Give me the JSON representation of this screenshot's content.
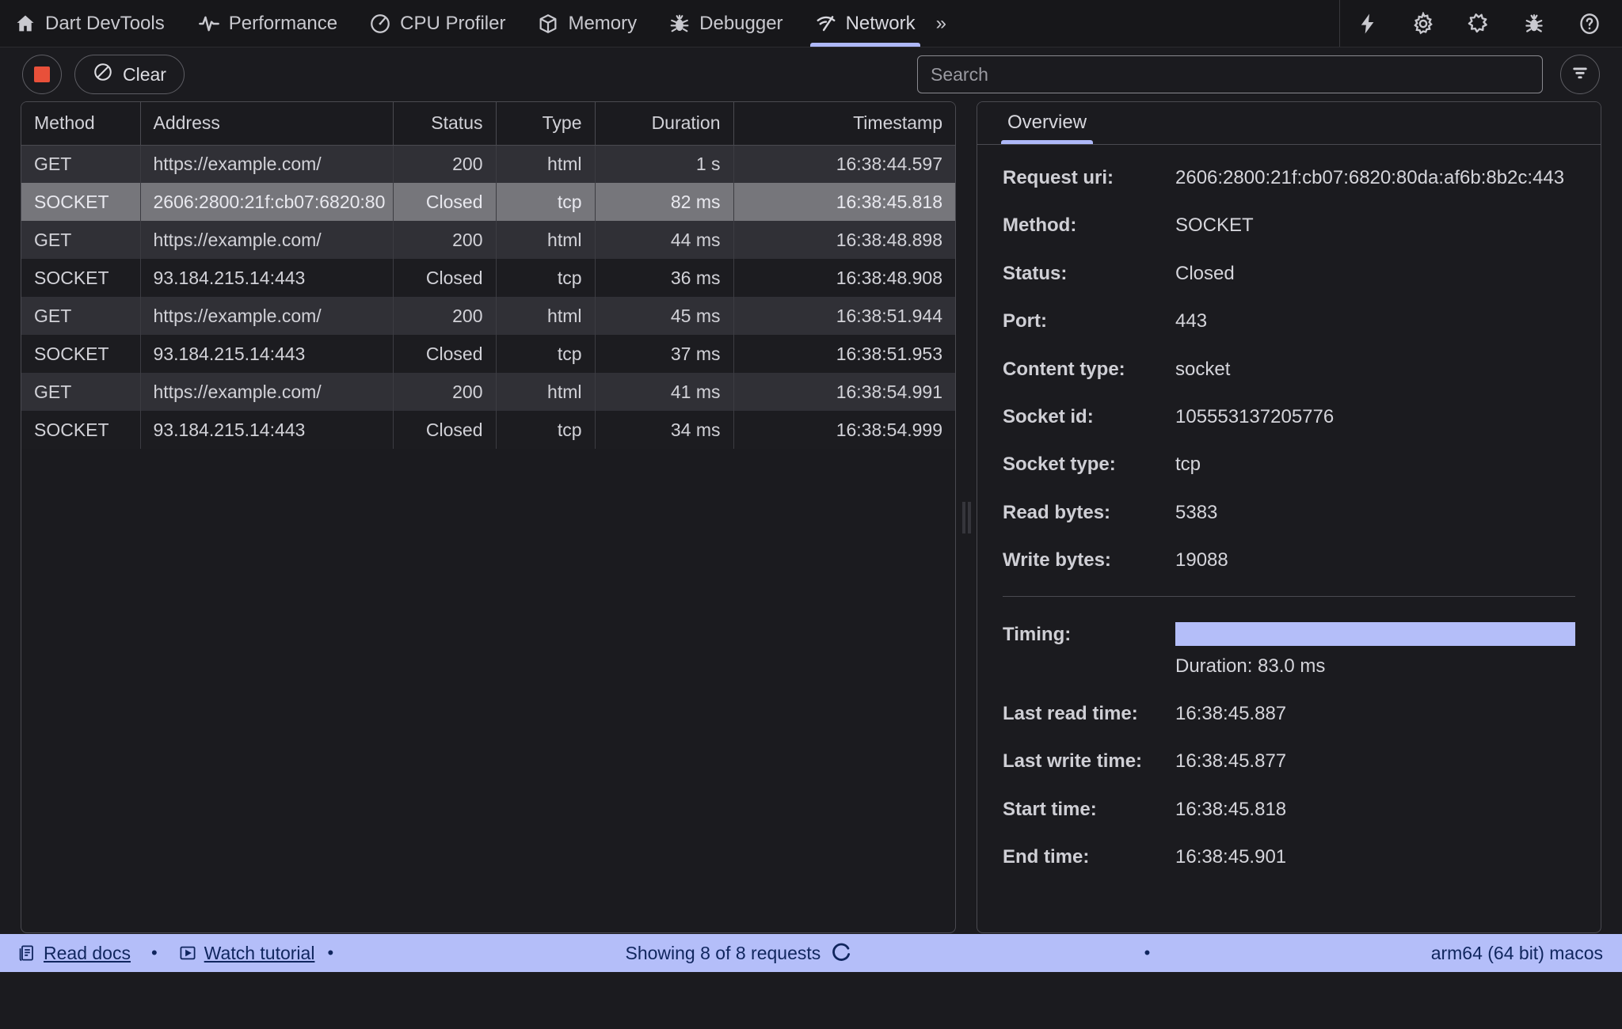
{
  "app": {
    "title": "Dart DevTools"
  },
  "nav": {
    "tabs": [
      {
        "label": "Dart DevTools",
        "icon": "home-icon",
        "active": false
      },
      {
        "label": "Performance",
        "icon": "pulse-icon",
        "active": false
      },
      {
        "label": "CPU Profiler",
        "icon": "speedometer-icon",
        "active": false
      },
      {
        "label": "Memory",
        "icon": "box-icon",
        "active": false
      },
      {
        "label": "Debugger",
        "icon": "bug-icon",
        "active": false
      },
      {
        "label": "Network",
        "icon": "network-icon",
        "active": true
      }
    ],
    "more_label": "»",
    "actions": [
      {
        "name": "hot-reload-icon",
        "title": "Hot Reload"
      },
      {
        "name": "gear-icon",
        "title": "Settings"
      },
      {
        "name": "extensions-icon",
        "title": "Extensions"
      },
      {
        "name": "report-bug-icon",
        "title": "Report a bug"
      },
      {
        "name": "help-icon",
        "title": "Help"
      }
    ]
  },
  "toolbar": {
    "stop_label": "",
    "clear_label": "Clear",
    "search": {
      "value": "",
      "placeholder": "Search"
    },
    "filter_label": ""
  },
  "requests": {
    "columns": [
      "Method",
      "Address",
      "Status",
      "Type",
      "Duration",
      "Timestamp"
    ],
    "rows": [
      {
        "method": "GET",
        "address": "https://example.com/",
        "status": "200",
        "type": "html",
        "duration": "1 s",
        "timestamp": "16:38:44.597",
        "selected": false
      },
      {
        "method": "SOCKET",
        "address": "2606:2800:21f:cb07:6820:80",
        "status": "Closed",
        "type": "tcp",
        "duration": "82 ms",
        "timestamp": "16:38:45.818",
        "selected": true
      },
      {
        "method": "GET",
        "address": "https://example.com/",
        "status": "200",
        "type": "html",
        "duration": "44 ms",
        "timestamp": "16:38:48.898",
        "selected": false
      },
      {
        "method": "SOCKET",
        "address": "93.184.215.14:443",
        "status": "Closed",
        "type": "tcp",
        "duration": "36 ms",
        "timestamp": "16:38:48.908",
        "selected": false
      },
      {
        "method": "GET",
        "address": "https://example.com/",
        "status": "200",
        "type": "html",
        "duration": "45 ms",
        "timestamp": "16:38:51.944",
        "selected": false
      },
      {
        "method": "SOCKET",
        "address": "93.184.215.14:443",
        "status": "Closed",
        "type": "tcp",
        "duration": "37 ms",
        "timestamp": "16:38:51.953",
        "selected": false
      },
      {
        "method": "GET",
        "address": "https://example.com/",
        "status": "200",
        "type": "html",
        "duration": "41 ms",
        "timestamp": "16:38:54.991",
        "selected": false
      },
      {
        "method": "SOCKET",
        "address": "93.184.215.14:443",
        "status": "Closed",
        "type": "tcp",
        "duration": "34 ms",
        "timestamp": "16:38:54.999",
        "selected": false
      }
    ]
  },
  "details": {
    "tabs": [
      {
        "label": "Overview",
        "active": true
      }
    ],
    "fields": [
      {
        "label": "Request uri:",
        "value": "2606:2800:21f:cb07:6820:80da:af6b:8b2c:443"
      },
      {
        "label": "Method:",
        "value": "SOCKET"
      },
      {
        "label": "Status:",
        "value": "Closed"
      },
      {
        "label": "Port:",
        "value": "443"
      },
      {
        "label": "Content type:",
        "value": "socket"
      },
      {
        "label": "Socket id:",
        "value": "105553137205776"
      },
      {
        "label": "Socket type:",
        "value": "tcp"
      },
      {
        "label": "Read bytes:",
        "value": "5383"
      },
      {
        "label": "Write bytes:",
        "value": "19088"
      }
    ],
    "timing": {
      "label": "Timing:",
      "duration_text": "Duration: 83.0 ms",
      "bar_color": "#b4bef9"
    },
    "times": [
      {
        "label": "Last read time:",
        "value": "16:38:45.887"
      },
      {
        "label": "Last write time:",
        "value": "16:38:45.877"
      },
      {
        "label": "Start time:",
        "value": "16:38:45.818"
      },
      {
        "label": "End time:",
        "value": "16:38:45.901"
      }
    ]
  },
  "statusbar": {
    "read_docs": "Read docs",
    "watch_tutorial": "Watch tutorial",
    "separator": "•",
    "showing": "Showing 8 of 8 requests",
    "platform": "arm64 (64 bit) macos",
    "background": "#b4bef9",
    "text_color": "#10265e"
  },
  "colors": {
    "accent": "#aeb8f8",
    "stop_red": "#e8503a",
    "panel_bg": "#1b1b1f",
    "row_even": "#303036",
    "row_odd": "#1c1c20",
    "row_selected": "#76767b"
  }
}
